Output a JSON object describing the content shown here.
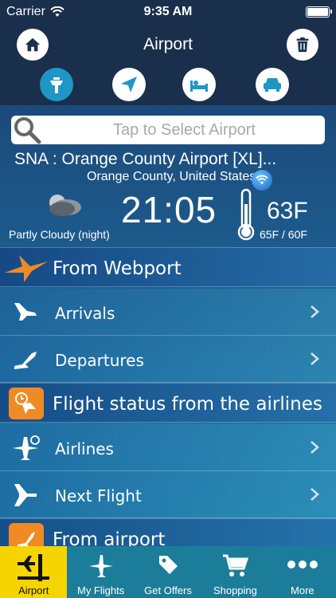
{
  "status": {
    "carrier": "Carrier",
    "time": "9:35 AM"
  },
  "header": {
    "title": "Airport"
  },
  "search": {
    "placeholder": "Tap to Select Airport"
  },
  "airport": {
    "name": "SNA : Orange County Airport  [XL]...",
    "location": "Orange County, United States"
  },
  "weather": {
    "local_time": "21:05",
    "temperature": "63F",
    "range": "65F / 60F",
    "condition": "Partly Cloudy (night)"
  },
  "sections": [
    {
      "label": "From Webport",
      "items": [
        "Arrivals",
        "Departures"
      ]
    },
    {
      "label": "Flight status from the airlines",
      "items": [
        "Airlines",
        "Next Flight"
      ]
    },
    {
      "label": "From airport"
    }
  ],
  "tabs": [
    {
      "label": "Airport",
      "icon": "airport-icon",
      "active": true
    },
    {
      "label": "My Flights",
      "icon": "plane-icon"
    },
    {
      "label": "Get Offers",
      "icon": "tag-icon"
    },
    {
      "label": "Shopping",
      "icon": "cart-icon"
    },
    {
      "label": "More",
      "icon": "more-icon"
    }
  ],
  "colors": {
    "accent": "#f6d400",
    "orange": "#f08a24",
    "header_bg": "#1a2f4c",
    "tabbar_bg": "#1c7d9a"
  }
}
